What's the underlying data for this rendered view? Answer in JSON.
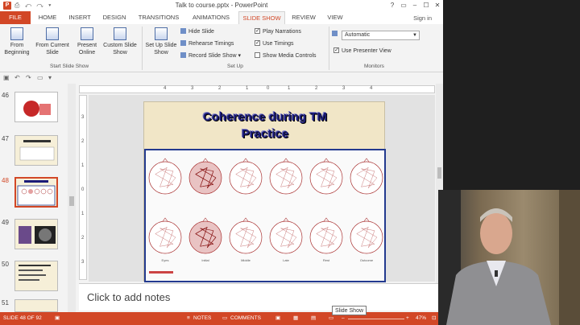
{
  "app": {
    "window_title": "Talk to course.pptx - PowerPoint",
    "window_controls": [
      "?",
      "▭",
      "–",
      "☐",
      "✕"
    ],
    "signin": "Sign in"
  },
  "tabs": [
    {
      "label": "FILE"
    },
    {
      "label": "HOME"
    },
    {
      "label": "INSERT"
    },
    {
      "label": "DESIGN"
    },
    {
      "label": "TRANSITIONS"
    },
    {
      "label": "ANIMATIONS"
    },
    {
      "label": "SLIDE SHOW"
    },
    {
      "label": "REVIEW"
    },
    {
      "label": "VIEW"
    }
  ],
  "ribbon": {
    "start_group": {
      "label": "Start Slide Show",
      "from_beginning": "From Beginning",
      "from_current": "From Current Slide",
      "present_online": "Present Online",
      "custom_slide_show": "Custom Slide Show"
    },
    "setup_group": {
      "label": "Set Up",
      "set_up_slide_show": "Set Up Slide Show",
      "hide_slide": "Hide Slide",
      "rehearse_timings": "Rehearse Timings",
      "record_slide_show": "Record Slide Show",
      "play_narrations": "Play Narrations",
      "use_timings": "Use Timings",
      "show_media_controls": "Show Media Controls"
    },
    "monitors_group": {
      "label": "Monitors",
      "monitor_value": "Automatic",
      "use_presenter_view": "Use Presenter View"
    }
  },
  "thumbnails": [
    {
      "num": "46",
      "selected": false
    },
    {
      "num": "47",
      "selected": false
    },
    {
      "num": "48",
      "selected": true
    },
    {
      "num": "49",
      "selected": false
    },
    {
      "num": "50",
      "selected": false
    },
    {
      "num": "51",
      "selected": false
    }
  ],
  "ruler": {
    "top_ticks": [
      "4",
      "3",
      "2",
      "1",
      "0",
      "1",
      "2",
      "3",
      "4"
    ],
    "left_ticks": [
      "3",
      "2",
      "1",
      "0",
      "1",
      "2",
      "3"
    ]
  },
  "slide": {
    "title_line1": "Coherence during TM",
    "title_line2": "Practice",
    "row_labels": [
      "Eyes",
      "Initial",
      "Middle",
      "Late",
      "Rest",
      "Outcome"
    ]
  },
  "notes": {
    "placeholder": "Click to add notes"
  },
  "status": {
    "slide_counter": "SLIDE 48 OF 92",
    "notes": "NOTES",
    "comments": "COMMENTS",
    "zoom": "47%",
    "tooltip": "Slide Show"
  },
  "colors": {
    "accent": "#d24726",
    "title_text": "#1b1b78",
    "slide_bg": "#f1e6c7",
    "box_border": "#233a8f"
  }
}
